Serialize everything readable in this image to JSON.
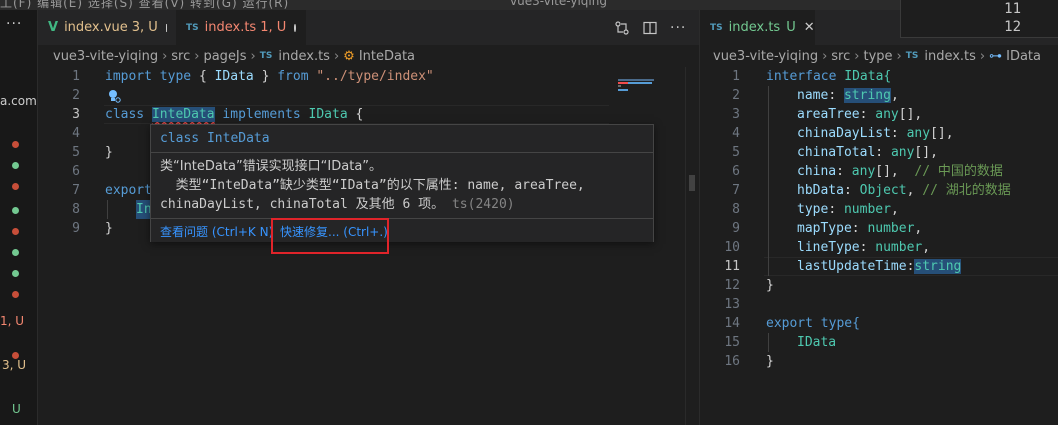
{
  "menu_fragment": "工(F) 编辑(E) 选择(S) 查看(V) 转到(G) 运行(R)",
  "title_fragment": "vue3-vite-yiqing",
  "sidebar": {
    "more": "···",
    "url_fragment": "a.com",
    "badge_1": "1, U",
    "badge_2": "3, U",
    "badge_3": "U"
  },
  "group1": {
    "tabs": [
      {
        "label": "index.vue",
        "status": "3, U",
        "type": "vue"
      },
      {
        "label": "index.ts",
        "status": "1, U",
        "type": "ts"
      }
    ],
    "ts_glyph": "TS",
    "breadcrumb": [
      "vue3-vite-yiqing",
      "src",
      "pageJs",
      "index.ts",
      "InteData"
    ],
    "code": {
      "l1_kw": "import",
      "l1_type": "type",
      "l1_brace_open": "{",
      "l1_name": "IData",
      "l1_brace_close": "}",
      "l1_from": "from",
      "l1_path": "\"../type/index\"",
      "l3_class": "class",
      "l3_name": "InteData",
      "l3_impl": "implements",
      "l3_iface": "IData",
      "l3_brace": "{",
      "l5": "}",
      "l7": "export",
      "l8": "In",
      "l9": "}"
    },
    "hover": {
      "signature": "class InteData",
      "line1": "类“InteData”错误实现接口“IData”。",
      "line2": "  类型“InteData”缺少类型“IData”的以下属性: name, areaTree,",
      "line3": "chinaDayList, chinaTotal 及其他 6 项。",
      "code_ref": "ts(2420)",
      "view_problem": "查看问题 (Ctrl+K N)",
      "quick_fix": "快速修复... (Ctrl+.)"
    }
  },
  "group2": {
    "tab": {
      "label": "index.ts",
      "status": "U"
    },
    "breadcrumb": [
      "vue3-vite-yiqing",
      "src",
      "type",
      "index.ts",
      "IData"
    ],
    "code": {
      "l1_kw": "interface",
      "l1_name": "IData{",
      "l2_prop": "name",
      "l2_type": "string",
      "l2_end": ",",
      "l3_prop": "areaTree",
      "l3_type": "any",
      "l3_end": "[],",
      "l4_prop": "chinaDayList",
      "l4_type": "any",
      "l4_end": "[],",
      "l5_prop": "chinaTotal",
      "l5_type": "any",
      "l5_end": "[],",
      "l6_prop": "china",
      "l6_type": "any",
      "l6_end": "[],",
      "l6_comment": "// 中国的数据",
      "l7_prop": "hbData",
      "l7_type": "Object",
      "l7_end": ",",
      "l7_comment": "// 湖北的数据",
      "l8_prop": "type",
      "l8_type": "number",
      "l8_end": ",",
      "l9_prop": "mapType",
      "l9_type": "number",
      "l9_end": ",",
      "l10_prop": "lineType",
      "l10_type": "number",
      "l10_end": ",",
      "l11_prop": "lastUpdateTime",
      "l11_type": "string",
      "l12": "}",
      "l14_kw": "export",
      "l14_type": "type{",
      "l15": "IData",
      "l16": "}"
    }
  },
  "floating_lines": [
    "11",
    "12"
  ],
  "line_numbers_1": [
    "1",
    "2",
    "3",
    "4",
    "5",
    "6",
    "7",
    "8",
    "9"
  ],
  "line_numbers_2": [
    "1",
    "2",
    "3",
    "4",
    "5",
    "6",
    "7",
    "8",
    "9",
    "10",
    "11",
    "12",
    "13",
    "14",
    "15",
    "16"
  ]
}
